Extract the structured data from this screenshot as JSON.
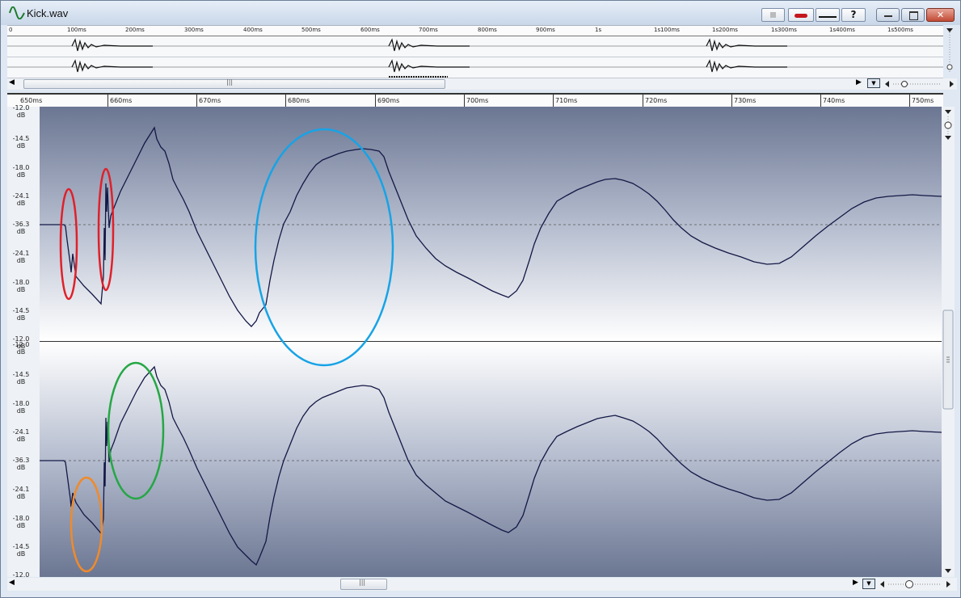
{
  "window": {
    "title": "Kick.wav"
  },
  "titlebar_tools": [
    {
      "name": "stop-tool-button",
      "label": ""
    },
    {
      "name": "record-tool-button",
      "label": ""
    },
    {
      "name": "line-tool-button",
      "label": ""
    },
    {
      "name": "help-button",
      "label": "?"
    }
  ],
  "overview_ruler": [
    "0",
    "100ms",
    "200ms",
    "300ms",
    "400ms",
    "500ms",
    "600ms",
    "700ms",
    "800ms",
    "900ms",
    "1s",
    "1s100ms",
    "1s200ms",
    "1s300ms",
    "1s400ms",
    "1s500ms"
  ],
  "main_ruler": [
    "650ms",
    "660ms",
    "670ms",
    "680ms",
    "690ms",
    "700ms",
    "710ms",
    "720ms",
    "730ms",
    "740ms",
    "750ms"
  ],
  "axis_labels": [
    "-12.0 dB",
    "-14.5 dB",
    "-18.0 dB",
    "-24.1 dB",
    "-36.3 dB",
    "-24.1 dB",
    "-18.0 dB",
    "-14.5 dB",
    "-12.0 dB"
  ],
  "colors": {
    "waveform": "#141845",
    "annotation_red": "#e0202a",
    "annotation_blue": "#17a3e6",
    "annotation_green": "#25a745",
    "annotation_orange": "#f08a2a"
  }
}
